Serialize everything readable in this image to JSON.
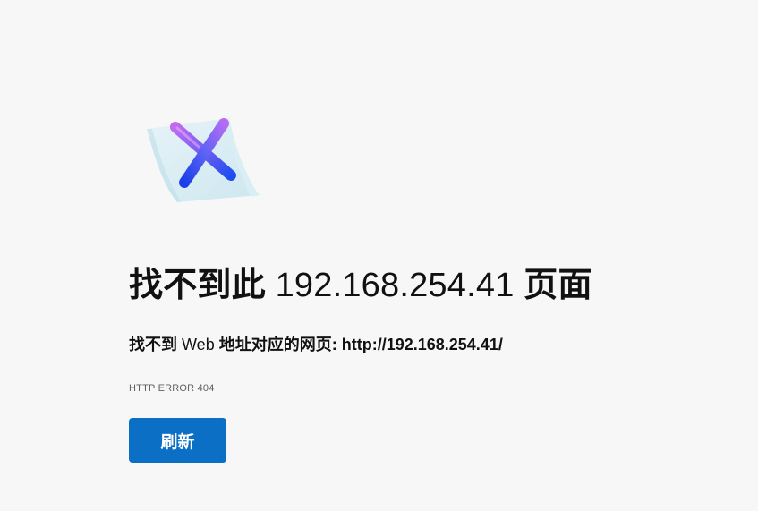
{
  "error_page": {
    "title_prefix": "找不到此",
    "title_host": "192.168.254.41",
    "title_suffix": "页面",
    "subtitle_prefix": "找不到",
    "subtitle_web": "Web",
    "subtitle_middle": "地址对应的网页:",
    "subtitle_url": "http://192.168.254.41/",
    "error_code": "HTTP ERROR 404",
    "reload_label": "刷新"
  },
  "icons": {
    "illustration": "page-not-found-x-icon"
  },
  "colors": {
    "background": "#f7f7f7",
    "button": "#0b6fc6",
    "button_text": "#ffffff",
    "x_gradient_start": "#c06af0",
    "x_gradient_end": "#1f4ef0"
  }
}
